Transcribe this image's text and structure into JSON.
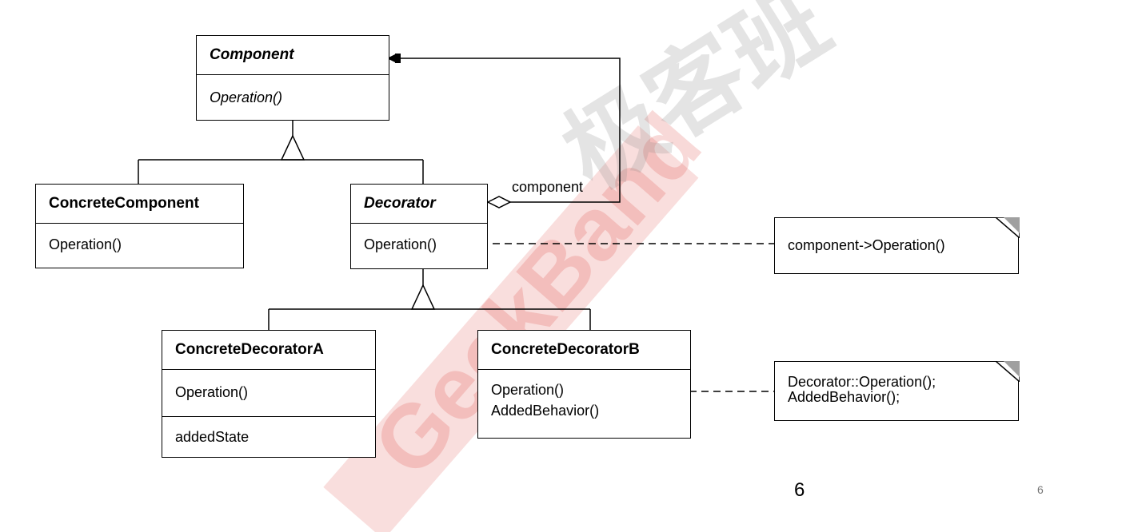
{
  "watermark": {
    "brand": "GeekBand",
    "chinese": "极客班",
    "color": "#d9342b"
  },
  "classes": {
    "component": {
      "name": "Component",
      "operations": [
        "Operation()"
      ]
    },
    "concrete_component": {
      "name": "ConcreteComponent",
      "operations": [
        "Operation()"
      ]
    },
    "decorator": {
      "name": "Decorator",
      "operations": [
        "Operation()"
      ]
    },
    "concrete_decorator_a": {
      "name": "ConcreteDecoratorA",
      "operations": [
        "Operation()"
      ],
      "attributes": [
        "addedState"
      ]
    },
    "concrete_decorator_b": {
      "name": "ConcreteDecoratorB",
      "operations": [
        "Operation()",
        "AddedBehavior()"
      ]
    }
  },
  "association_label": "component",
  "notes": [
    {
      "lines": [
        "component->Operation()"
      ]
    },
    {
      "lines": [
        "Decorator::Operation();",
        "AddedBehavior();"
      ]
    }
  ],
  "page_number_center": "6",
  "page_number_right": "6"
}
